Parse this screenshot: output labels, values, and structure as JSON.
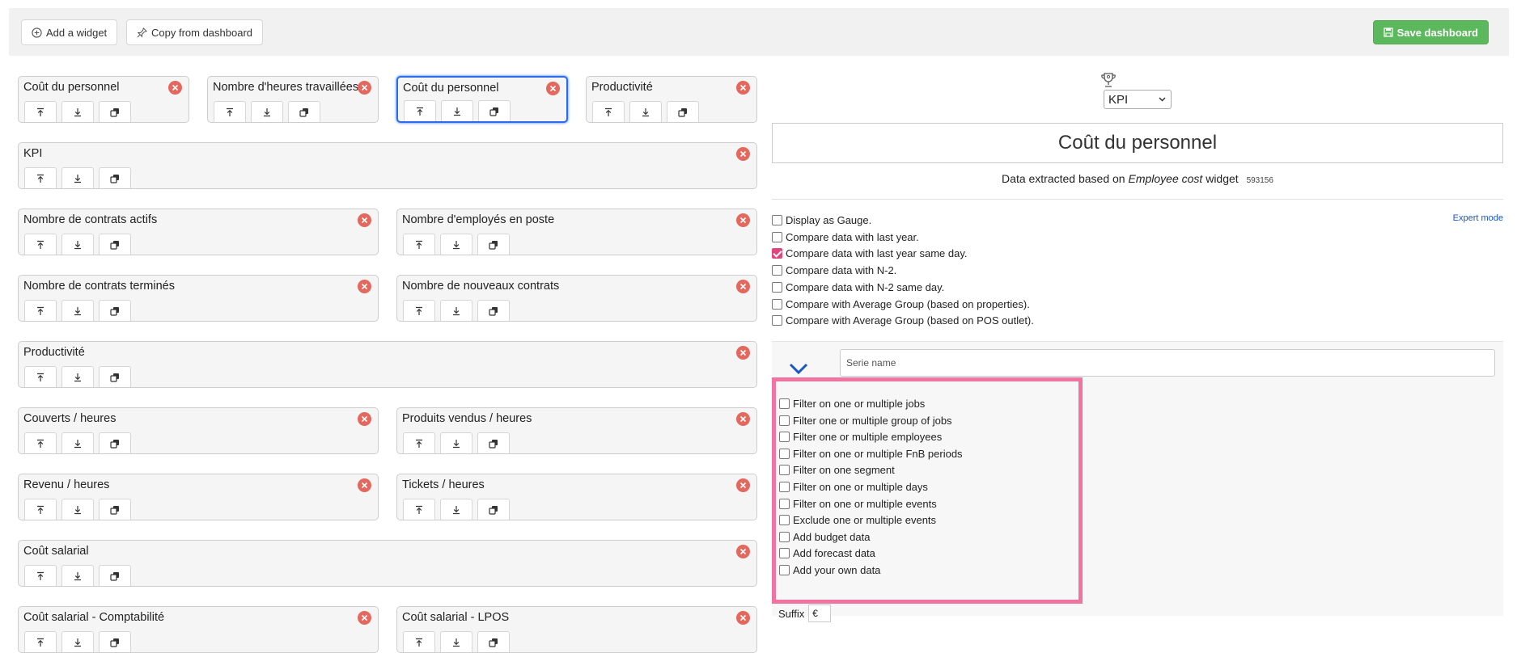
{
  "toolbar": {
    "add_widget": "Add a widget",
    "copy_dashboard": "Copy from dashboard",
    "save_dashboard": "Save dashboard"
  },
  "widgets": [
    {
      "title": "Coût du personnel"
    },
    {
      "title": "Nombre d'heures travaillées"
    },
    {
      "title": "Coût du personnel"
    },
    {
      "title": "Productivité"
    },
    {
      "title": "KPI"
    },
    {
      "title": "Nombre de contrats actifs"
    },
    {
      "title": "Nombre d'employés en poste"
    },
    {
      "title": "Nombre de contrats terminés"
    },
    {
      "title": "Nombre de nouveaux contrats"
    },
    {
      "title": "Productivité"
    },
    {
      "title": "Couverts / heures"
    },
    {
      "title": "Produits vendus / heures"
    },
    {
      "title": "Revenu / heures"
    },
    {
      "title": "Tickets / heures"
    },
    {
      "title": "Coût salarial"
    },
    {
      "title": "Coût salarial - Comptabilité"
    },
    {
      "title": "Coût salarial - LPOS"
    }
  ],
  "editor": {
    "type_selected": "KPI",
    "widget_title": "Coût du personnel",
    "extracted_prefix": "Data extracted based on",
    "extracted_widget": "Employee cost",
    "extracted_suffix": "widget",
    "widget_id": "593156",
    "expert_mode": "Expert mode",
    "options": [
      {
        "label": "Display as Gauge.",
        "checked": false
      },
      {
        "label": "Compare data with last year.",
        "checked": false
      },
      {
        "label": "Compare data with last year same day.",
        "checked": true
      },
      {
        "label": "Compare data with N-2.",
        "checked": false
      },
      {
        "label": "Compare data with N-2 same day.",
        "checked": false
      },
      {
        "label": "Compare with Average Group (based on properties).",
        "checked": false
      },
      {
        "label": "Compare with Average Group (based on POS outlet).",
        "checked": false
      }
    ],
    "series_name_placeholder": "Serie name",
    "filters": [
      {
        "label": "Filter on one or multiple jobs"
      },
      {
        "label": "Filter one or multiple group of jobs"
      },
      {
        "label": "Filter one or multiple employees"
      },
      {
        "label": "Filter on one or multiple FnB periods"
      },
      {
        "label": "Filter on one segment"
      },
      {
        "label": "Filter on one or multiple days"
      },
      {
        "label": "Filter on one or multiple events"
      },
      {
        "label": "Exclude one or multiple events"
      },
      {
        "label": "Add budget data"
      },
      {
        "label": "Add forecast data"
      },
      {
        "label": "Add your own data"
      }
    ],
    "suffix_label": "Suffix",
    "suffix_value": "€"
  },
  "colors": {
    "accent_selected": "#2b6de8",
    "save_green": "#5cb85c",
    "close_red": "#e4685d",
    "highlight_pink": "#f0749f",
    "checkbox_pink": "#e0457b"
  }
}
